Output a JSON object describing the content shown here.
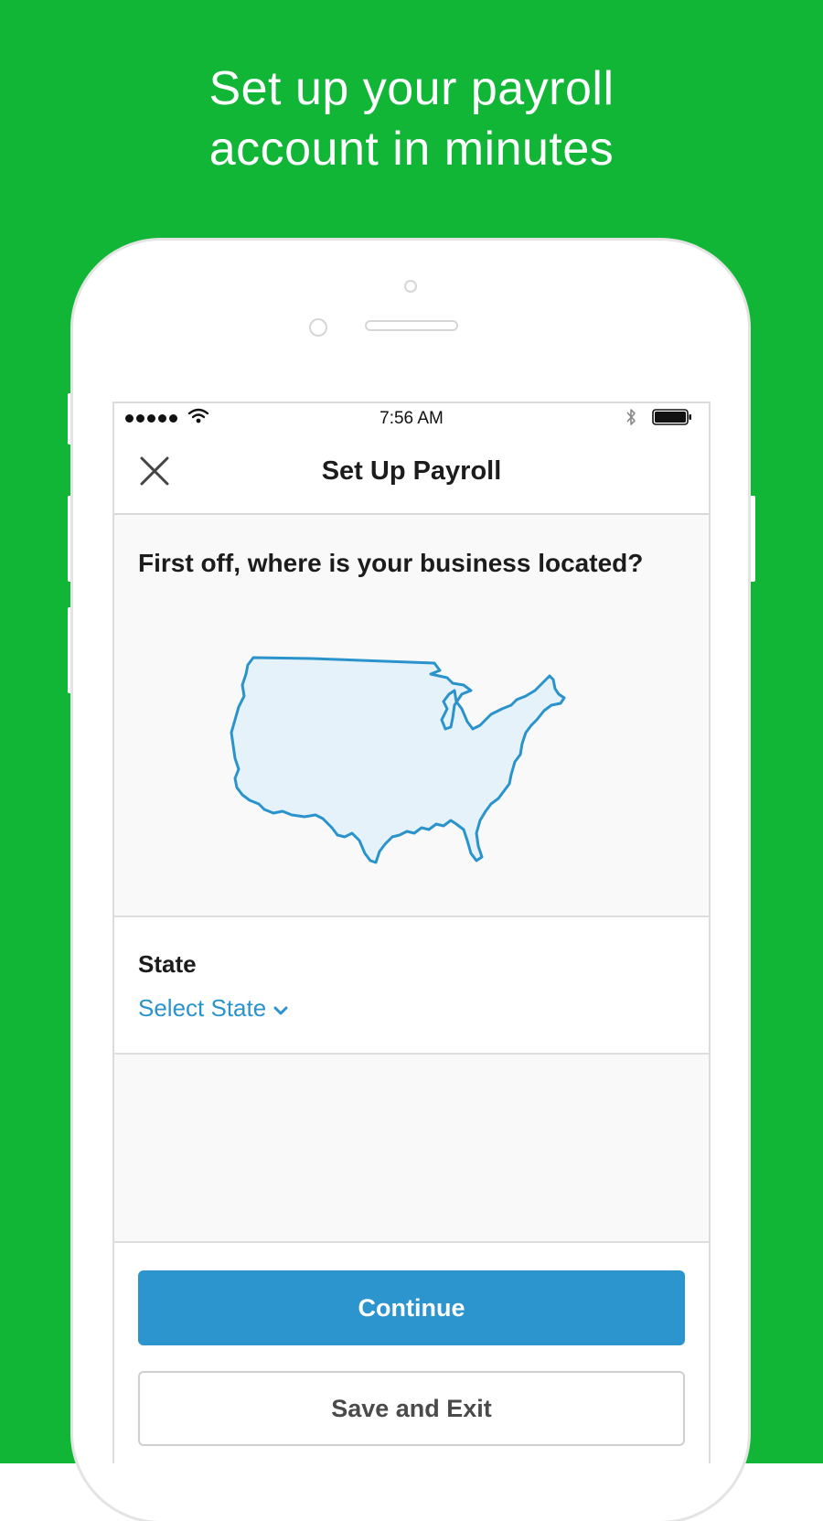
{
  "promo": {
    "headline_line1": "Set up your payroll",
    "headline_line2": "account in minutes",
    "background_color": "#12b637"
  },
  "status_bar": {
    "time": "7:56 AM"
  },
  "nav": {
    "title": "Set Up Payroll",
    "close_icon": "close-icon"
  },
  "location": {
    "question": "First off, where is your business located?",
    "map_icon": "usa-map-icon"
  },
  "state_field": {
    "label": "State",
    "value": "Select State"
  },
  "actions": {
    "continue_label": "Continue",
    "save_exit_label": "Save and Exit"
  },
  "colors": {
    "accent": "#2c95cd",
    "map_fill": "#e6f2f9",
    "map_stroke": "#2b93cc"
  }
}
